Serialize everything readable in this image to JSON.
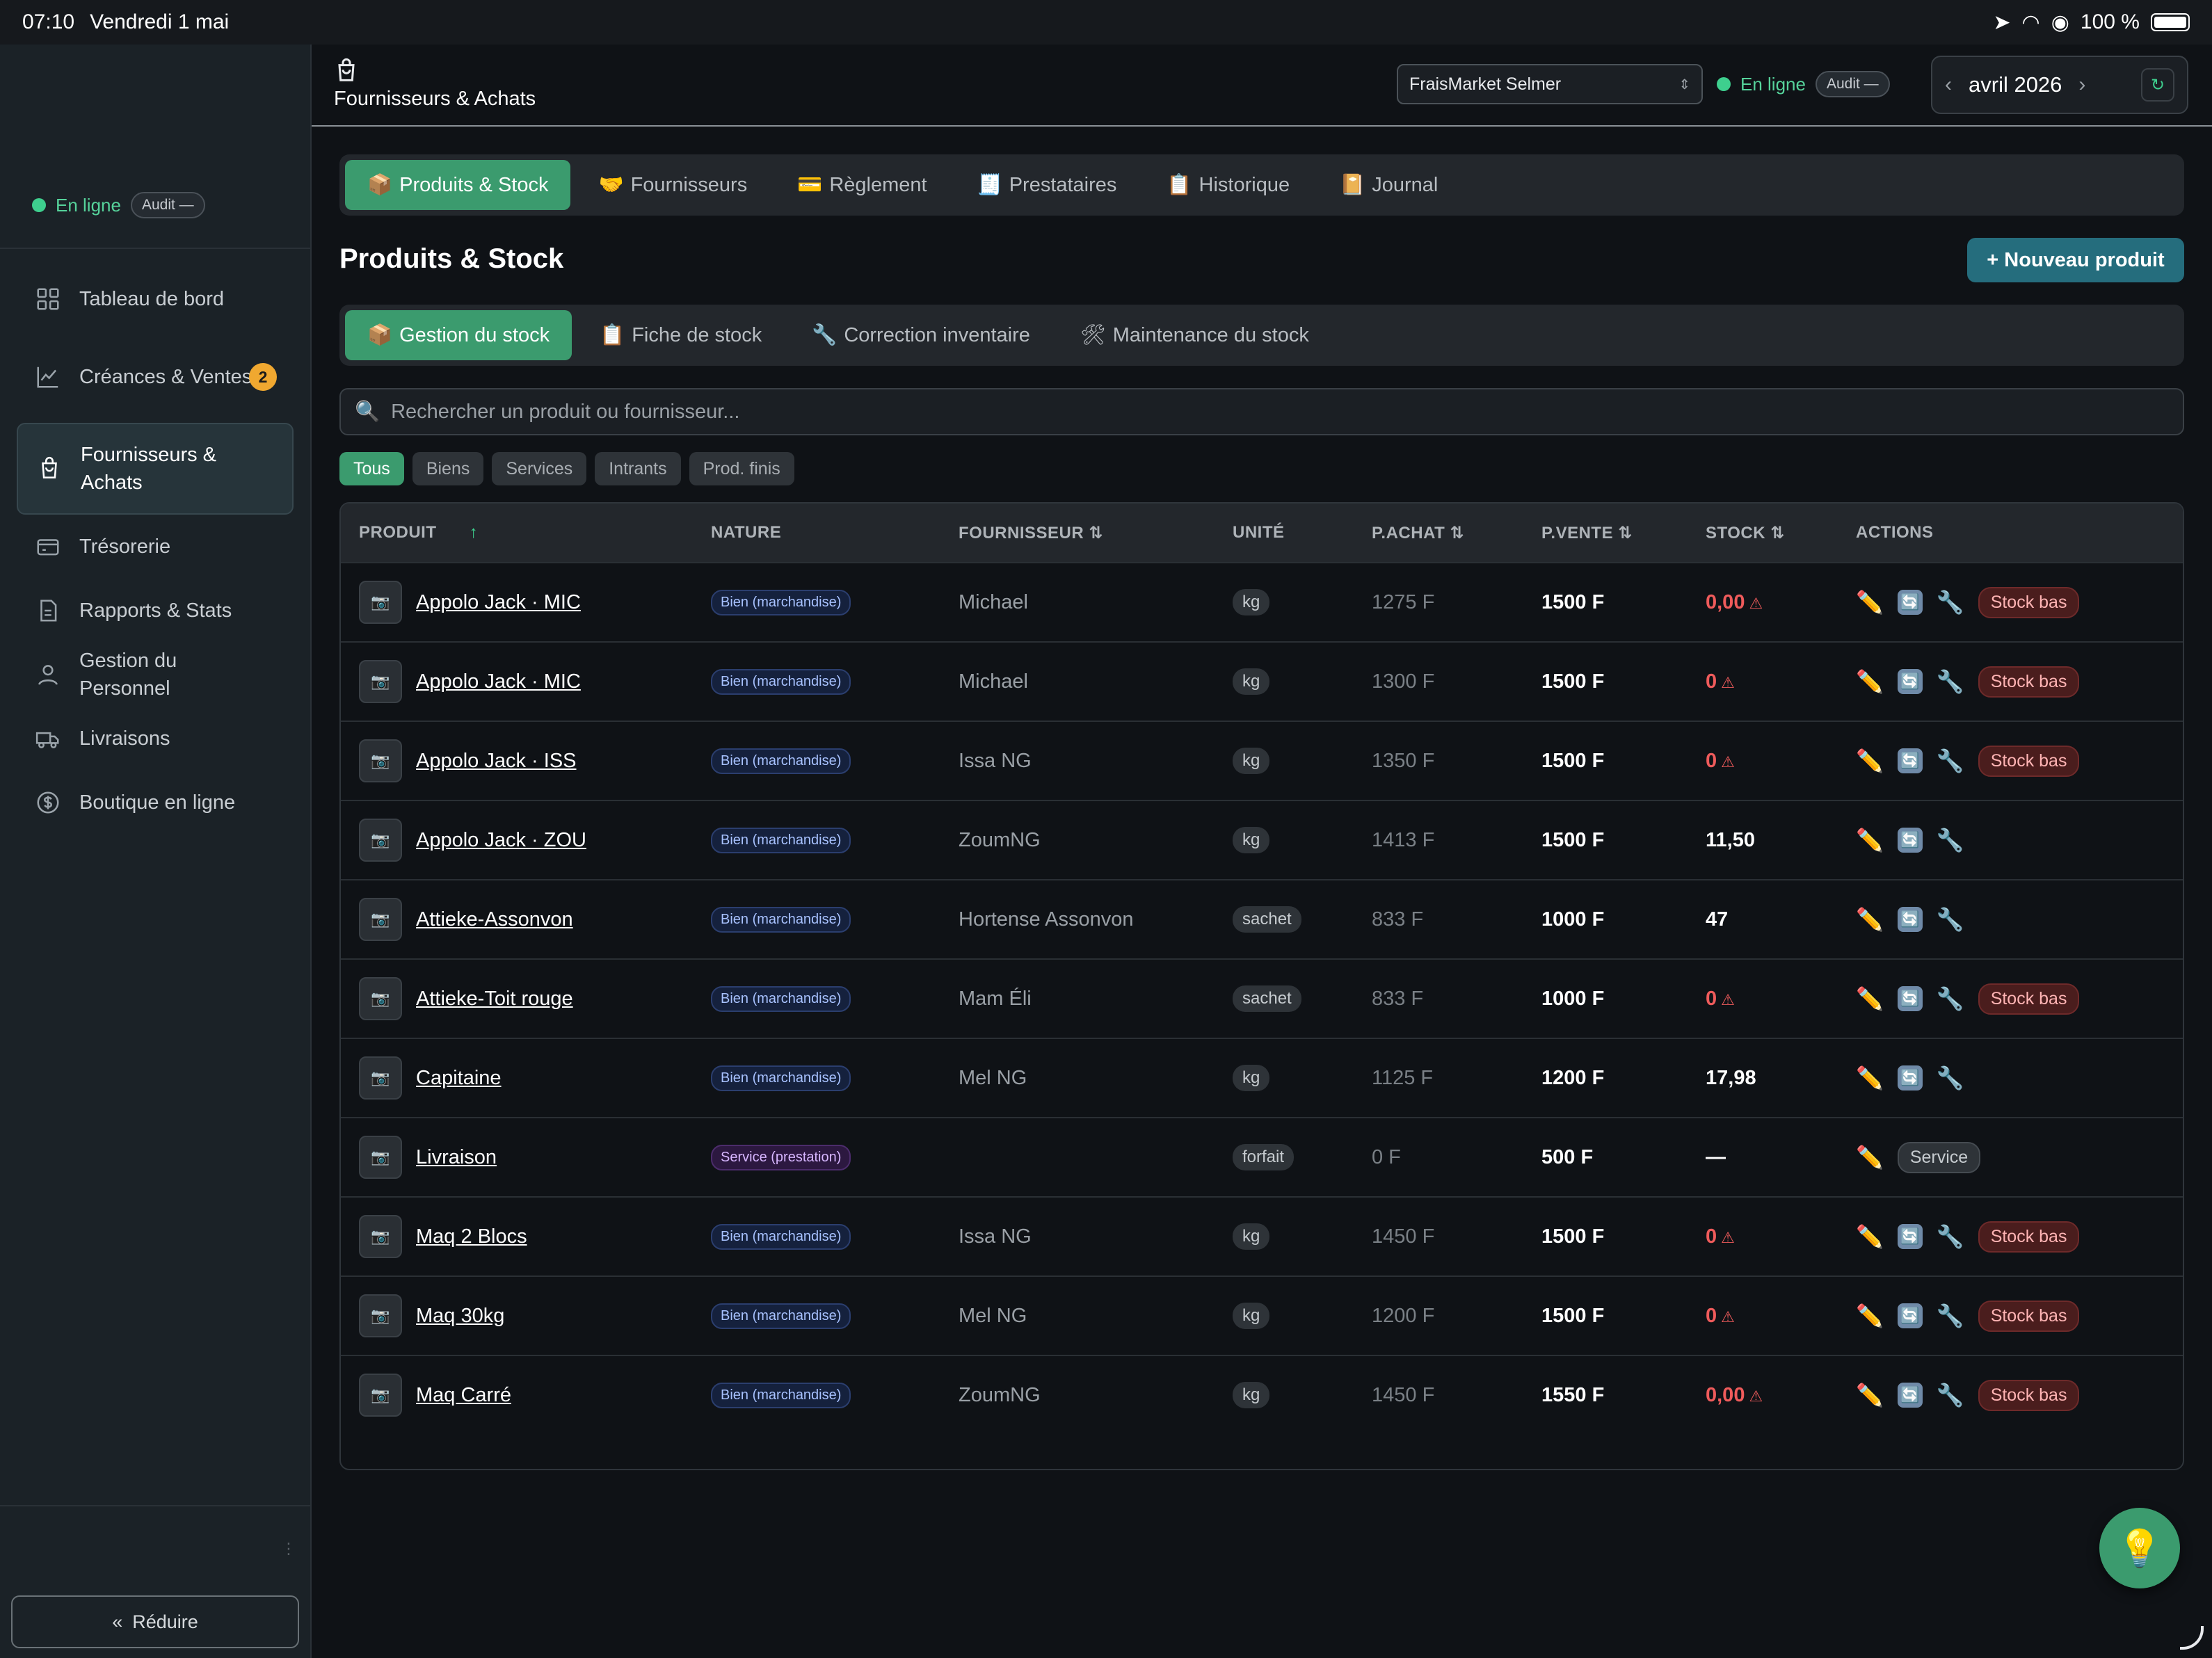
{
  "status_bar": {
    "time": "07:10",
    "date": "Vendredi 1 mai",
    "battery": "100 %"
  },
  "sidebar": {
    "status": {
      "online": "En ligne",
      "audit": "Audit —"
    },
    "items": [
      {
        "label": "Tableau de bord",
        "icon": "grid-icon"
      },
      {
        "label": "Créances & Ventes",
        "icon": "chart-line-icon",
        "badge": "2"
      },
      {
        "label": "Fournisseurs & Achats",
        "icon": "shopping-bag-icon",
        "active": true
      },
      {
        "label": "Trésorerie",
        "icon": "wallet-icon"
      },
      {
        "label": "Rapports & Stats",
        "icon": "document-icon"
      },
      {
        "label": "Gestion du Personnel",
        "icon": "person-icon"
      },
      {
        "label": "Livraisons",
        "icon": "truck-icon"
      },
      {
        "label": "Boutique en ligne",
        "icon": "currency-icon"
      }
    ],
    "reduce_label": "Réduire"
  },
  "topbar": {
    "title": "Fournisseurs & Achats",
    "store_select": "FraisMarket Selmer",
    "online": "En ligne",
    "audit": "Audit —",
    "month": "avril 2026"
  },
  "main_tabs": [
    {
      "icon": "📦",
      "label": "Produits & Stock",
      "active": true
    },
    {
      "icon": "🤝",
      "label": "Fournisseurs"
    },
    {
      "icon": "💳",
      "label": "Règlement"
    },
    {
      "icon": "🧾",
      "label": "Prestataires"
    },
    {
      "icon": "📋",
      "label": "Historique"
    },
    {
      "icon": "📔",
      "label": "Journal"
    }
  ],
  "page": {
    "title": "Produits & Stock",
    "new_product": "+ Nouveau produit"
  },
  "sub_tabs": [
    {
      "icon": "📦",
      "label": "Gestion du stock",
      "active": true
    },
    {
      "icon": "📋",
      "label": "Fiche de stock"
    },
    {
      "icon": "🔧",
      "label": "Correction inventaire"
    },
    {
      "icon": "🛠",
      "label": "Maintenance du stock"
    }
  ],
  "search": {
    "placeholder": "Rechercher un produit ou fournisseur..."
  },
  "filters": [
    "Tous",
    "Biens",
    "Services",
    "Intrants",
    "Prod. finis"
  ],
  "table": {
    "headers": {
      "produit": "PRODUIT",
      "nature": "NATURE",
      "fournisseur": "FOURNISSEUR",
      "unite": "UNITÉ",
      "pachat": "P.ACHAT",
      "pvente": "P.VENTE",
      "stock": "STOCK",
      "actions": "ACTIONS"
    },
    "low_stock_label": "Stock bas",
    "service_label": "Service",
    "rows": [
      {
        "name": "Appolo Jack · MIC",
        "nature": "Bien (marchandise)",
        "supplier": "Michael",
        "unit": "kg",
        "buy": "1275 F",
        "sell": "1500 F",
        "stock": "0,00",
        "low": true
      },
      {
        "name": "Appolo Jack · MIC",
        "nature": "Bien (marchandise)",
        "supplier": "Michael",
        "unit": "kg",
        "buy": "1300 F",
        "sell": "1500 F",
        "stock": "0",
        "low": true
      },
      {
        "name": "Appolo Jack · ISS",
        "nature": "Bien (marchandise)",
        "supplier": "Issa NG",
        "unit": "kg",
        "buy": "1350 F",
        "sell": "1500 F",
        "stock": "0",
        "low": true
      },
      {
        "name": "Appolo Jack · ZOU",
        "nature": "Bien (marchandise)",
        "supplier": "ZoumNG",
        "unit": "kg",
        "buy": "1413 F",
        "sell": "1500 F",
        "stock": "11,50",
        "low": false
      },
      {
        "name": "Attieke-Assonvon",
        "nature": "Bien (marchandise)",
        "supplier": "Hortense Assonvon",
        "unit": "sachet",
        "buy": "833 F",
        "sell": "1000 F",
        "stock": "47",
        "low": false
      },
      {
        "name": "Attieke-Toit rouge",
        "nature": "Bien (marchandise)",
        "supplier": "Mam Éli",
        "unit": "sachet",
        "buy": "833 F",
        "sell": "1000 F",
        "stock": "0",
        "low": true
      },
      {
        "name": "Capitaine",
        "nature": "Bien (marchandise)",
        "supplier": "Mel NG",
        "unit": "kg",
        "buy": "1125 F",
        "sell": "1200 F",
        "stock": "17,98",
        "low": false
      },
      {
        "name": "Livraison",
        "nature": "Service (prestation)",
        "supplier": "",
        "unit": "forfait",
        "buy": "0 F",
        "sell": "500 F",
        "stock": "—",
        "service": true
      },
      {
        "name": "Maq 2 Blocs",
        "nature": "Bien (marchandise)",
        "supplier": "Issa NG",
        "unit": "kg",
        "buy": "1450 F",
        "sell": "1500 F",
        "stock": "0",
        "low": true
      },
      {
        "name": "Maq 30kg",
        "nature": "Bien (marchandise)",
        "supplier": "Mel NG",
        "unit": "kg",
        "buy": "1200 F",
        "sell": "1500 F",
        "stock": "0",
        "low": true
      },
      {
        "name": "Maq Carré",
        "nature": "Bien (marchandise)",
        "supplier": "ZoumNG",
        "unit": "kg",
        "buy": "1450 F",
        "sell": "1550 F",
        "stock": "0,00",
        "low": true
      }
    ]
  }
}
